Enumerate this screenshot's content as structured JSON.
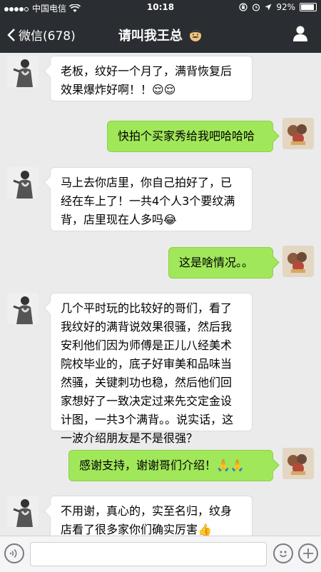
{
  "status_bar": {
    "carrier": "中国电信",
    "time": "10:18",
    "battery": "92%"
  },
  "nav": {
    "back_label": "微信(678)",
    "title": "请叫我王总"
  },
  "messages": [
    {
      "side": "in",
      "text": "老板，纹好一个月了，满背恢复后效果爆炸好啊！！😌😌"
    },
    {
      "side": "out",
      "text": "快拍个买家秀给我吧哈哈哈"
    },
    {
      "side": "in",
      "text": "马上去你店里，你自己拍好了，已经在车上了！一共4个人3个要纹满背，店里现在人多吗😂"
    },
    {
      "side": "out",
      "text": "这是啥情况。。"
    },
    {
      "side": "in",
      "text": "几个平时玩的比较好的哥们，看了我纹好的满背说效果很骚，然后我安利他们因为师傅是正儿八经美术院校毕业的，底子好审美和品味当然骚，关键刺功也稳，然后他们回家想好了一致决定过来先交定金设计图，一共3个满背。。说实话，这一波介绍朋友是不是很强？"
    },
    {
      "side": "out",
      "text": "感谢支持，谢谢哥们介绍！🙏🙏"
    },
    {
      "side": "in",
      "text": "不用谢，真心的，实至名归，纹身店看了很多家你们确实厉害👍"
    }
  ],
  "icons": {
    "back": "chevron-left-icon",
    "profile": "person-icon",
    "voice": "voice-icon",
    "emoji": "emoji-icon",
    "plus": "plus-icon"
  },
  "colors": {
    "nav_bg": "#2a2d31",
    "outgoing_bubble": "#a0e75a",
    "incoming_bubble": "#ffffff",
    "chat_bg": "#ebebeb"
  }
}
